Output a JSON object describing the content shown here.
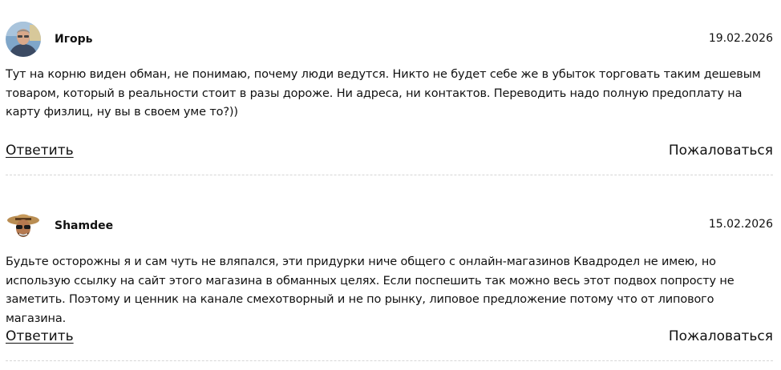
{
  "comments": [
    {
      "author": "Игорь",
      "date": "19.02.2026",
      "text": "Тут на корню виден обман, не понимаю, почему люди ведутся. Никто не будет себе же в убыток торговать таким дешевым товаром, который в реальности стоит в разы дороже. Ни адреса, ни контактов. Переводить надо полную предоплату на карту физлиц, ну вы в своем уме то?))",
      "reply_label": "Ответить",
      "report_label": "Пожаловаться"
    },
    {
      "author": "Shamdee",
      "date": "15.02.2026",
      "text": "Будьте осторожны я и сам чуть не вляпался, эти придурки ниче общего с онлайн-магазинов Квадродел не имею, но использую ссылку на сайт этого магазина в обманных целях. Если поспешить так можно весь этот подвох попросту не заметить. Поэтому и ценник на канале смехотворный и не по рынку, липовое предложение потому что от липового магазина.",
      "reply_label": "Ответить",
      "report_label": "Пожаловаться"
    }
  ]
}
